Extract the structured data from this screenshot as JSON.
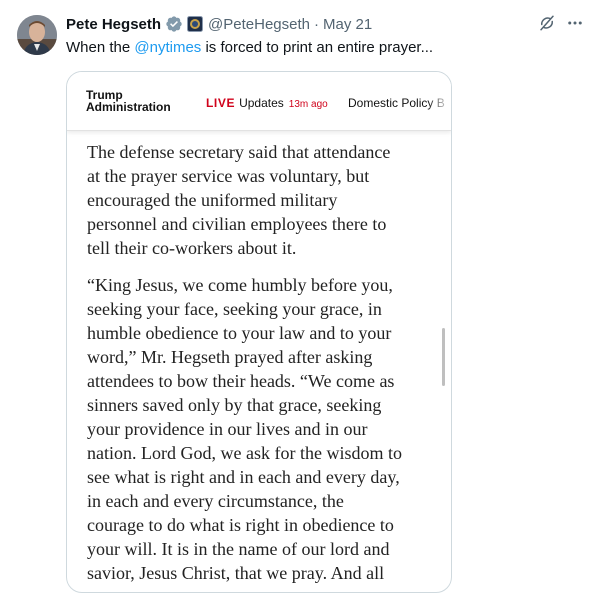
{
  "tweet": {
    "author_name": "Pete Hegseth",
    "handle": "@PeteHegseth",
    "separator": "·",
    "date": "May 21",
    "text_before": "When the ",
    "mention": "@nytimes",
    "text_after": " is forced to print an entire prayer..."
  },
  "nyt_header": {
    "section_line1": "Trump",
    "section_line2": "Administration",
    "live_label": "LIVE",
    "updates_label": "Updates",
    "time_ago": "13m ago",
    "next_tab": "Domestic Policy B"
  },
  "article": {
    "paragraph1": [
      "The defense secretary said that attendance",
      "at the prayer service was voluntary, but",
      "encouraged the uniformed military",
      "personnel and civilian employees there to",
      "tell their co-workers about it."
    ],
    "paragraph2": [
      "“King Jesus, we come humbly before you,",
      "seeking your face, seeking your grace, in",
      "humble obedience to your law and to your",
      "word,” Mr. Hegseth prayed after asking",
      "attendees to bow their heads. “We come as",
      "sinners saved only by that grace, seeking",
      "your providence in our lives and in our",
      "nation. Lord God, we ask for the wisdom to",
      "see what is right and in each and every day,",
      "in each and every circumstance, the",
      "courage to do what is right in obedience to",
      "your will. It is in the name of our lord and",
      "savior, Jesus Christ, that we pray. And all"
    ]
  },
  "icons": {
    "verified": "verified-badge-icon",
    "affiliation": "government-seal-icon",
    "grok": "grok-icon",
    "more": "more-options-icon"
  },
  "colors": {
    "accent": "#1d9bf0",
    "nyt_live_red": "#d0021b",
    "verified_gray": "#829aab",
    "secondary_text": "#536471"
  }
}
